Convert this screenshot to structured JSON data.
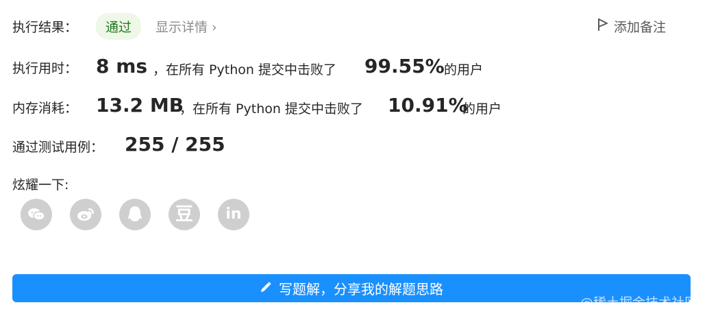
{
  "result": {
    "label": "执行结果：",
    "status_badge": "通过",
    "details_link": "显示详情 ›",
    "add_note": "添加备注"
  },
  "runtime": {
    "label": "执行用时：",
    "value": "8 ms",
    "text1": "，在所有 Python 提交中击败了",
    "percent": "99.55%",
    "text2": "的用户"
  },
  "memory": {
    "label": "内存消耗：",
    "value": "13.2 MB",
    "text1": "，在所有 Python 提交中击败了",
    "percent": "10.91%",
    "text2": "的用户"
  },
  "tests": {
    "label": "通过测试用例：",
    "value": "255 / 255"
  },
  "share": {
    "label": "炫耀一下:",
    "icons": [
      "wechat-icon",
      "weibo-icon",
      "qq-icon",
      "douban-icon",
      "linkedin-icon"
    ],
    "douban_glyph": "豆",
    "linkedin_glyph": "in"
  },
  "cta": {
    "label": "写题解，分享我的解题思路"
  },
  "watermark": "@稀土掘金技术社区",
  "colors": {
    "accent": "#1a90ff",
    "success_bg": "#eef7e8",
    "success_text": "#1f7a1f",
    "icon_gray": "#cfcfcf"
  }
}
